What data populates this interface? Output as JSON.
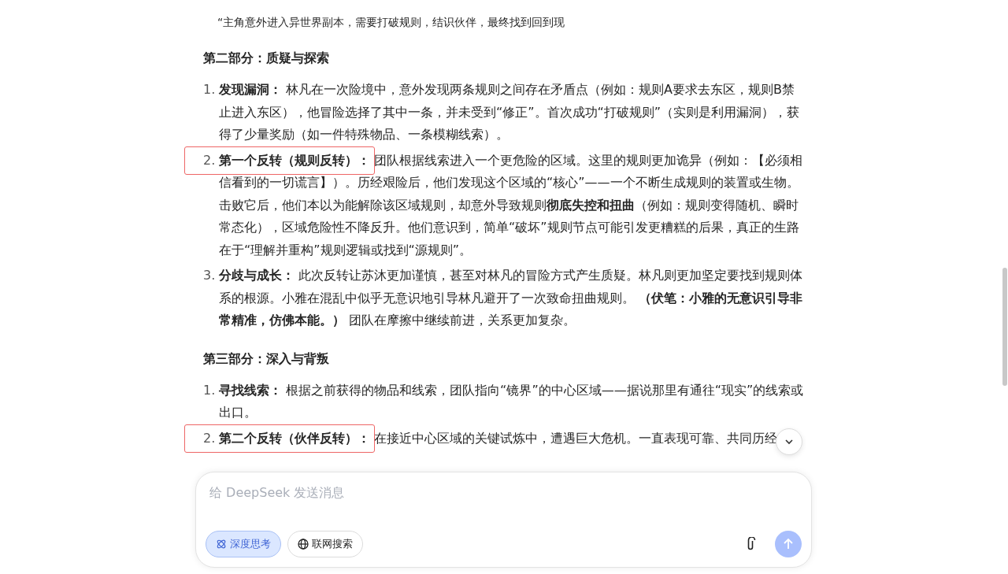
{
  "quote_line": "“主角意外进入异世界副本，需要打破规则，结识伙伴，最终找到回到现",
  "sections": [
    {
      "heading": "第二部分：质疑与探索",
      "items": [
        {
          "number": "1.",
          "label": "发现漏洞：",
          "highlighted": false,
          "text": "林凡在一次险境中，意外发现两条规则之间存在矛盾点（例如：规则A要求去东区，规则B禁止进入东区），他冒险选择了其中一条，并未受到“修正”。首次成功“打破规则”（实则是利用漏洞），获得了少量奖励（如一件特殊物品、一条模糊线索）。"
        },
        {
          "number": "2.",
          "label": "第一个反转（规则反转）：",
          "highlighted": true,
          "text": "团队根据线索进入一个更危险的区域。这里的规则更加诡异（例如：【必须相信看到的一切谎言】）。历经艰险后，他们发现这个区域的“核心”——一个不断生成规则的装置或生物。击败它后，他们本以为能解除该区域规则，却意外导致规则**彻底失控和扭曲**（例如：规则变得随机、瞬时常态化），区域危险性不降反升。他们意识到，简单“破坏”规则节点可能引发更糟糕的后果，真正的生路在于“理解并重构”规则逻辑或找到“源规则”。"
        },
        {
          "number": "3.",
          "label": "分歧与成长：",
          "highlighted": false,
          "text": "此次反转让苏沐更加谨慎，甚至对林凡的冒险方式产生质疑。林凡则更加坚定要找到规则体系的根源。小雅在混乱中似乎无意识地引导林凡避开了一次致命扭曲规则。 **（伏笔：小雅的无意识引导非常精准，仿佛本能。）** 团队在摩擦中继续前进，关系更加复杂。"
        }
      ]
    },
    {
      "heading": "第三部分：深入与背叛",
      "items": [
        {
          "number": "1.",
          "label": "寻找线索：",
          "highlighted": false,
          "text": "根据之前获得的物品和线索，团队指向“镜界”的中心区域——据说那里有通往“现实”的线索或出口。"
        },
        {
          "number": "2.",
          "label": "第二个反转（伙伴反转）：",
          "highlighted": true,
          "text": "在接近中心区域的关键试炼中，遭遇巨大危机。一直表现可靠、共同历经"
        }
      ]
    }
  ],
  "composer": {
    "placeholder": "给 DeepSeek 发送消息",
    "toggles": [
      {
        "kind": "think",
        "label": "深度思考",
        "selected": true
      },
      {
        "kind": "web",
        "label": "联网搜索",
        "selected": false
      }
    ]
  }
}
